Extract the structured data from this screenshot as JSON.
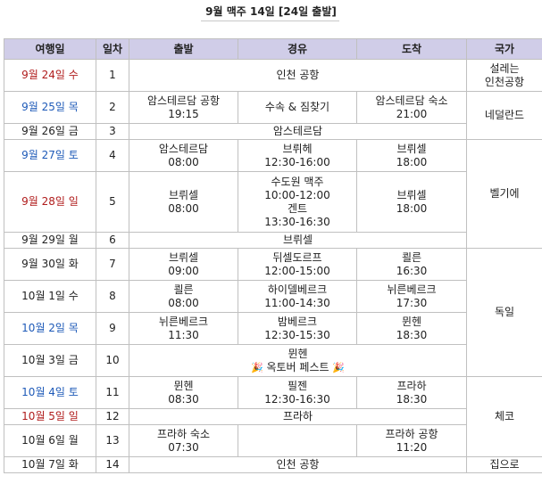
{
  "title": "9월 맥주 14일 [24일 출발]",
  "columns": [
    "여행일",
    "일차",
    "출발",
    "경유",
    "도착",
    "국가"
  ],
  "rows": [
    {
      "date": "9월 24일 수",
      "tone": "red",
      "day": "1",
      "merged": "인천 공항"
    },
    {
      "date": "9월 25일 목",
      "tone": "blue",
      "day": "2",
      "dep": "암스테르담 공항",
      "dep_time": "19:15",
      "via": "수속 & 짐찾기",
      "arr": "암스테르담 숙소",
      "arr_time": "21:00"
    },
    {
      "date": "9월 26일 금",
      "tone": "black",
      "day": "3",
      "merged": "암스테르담"
    },
    {
      "date": "9월 27일 토",
      "tone": "blue",
      "day": "4",
      "dep": "암스테르담",
      "dep_time": "08:00",
      "via": "브뤼헤",
      "via_time": "12:30-16:00",
      "arr": "브뤼셀",
      "arr_time": "18:00"
    },
    {
      "date": "9월 28일 일",
      "tone": "red",
      "day": "5",
      "dep": "브뤼셀",
      "dep_time": "08:00",
      "via": "수도원 맥주",
      "via_time": "10:00-12:00",
      "via2": "겐트",
      "via2_time": "13:30-16:30",
      "arr": "브뤼셀",
      "arr_time": "18:00"
    },
    {
      "date": "9월 29일 월",
      "tone": "black",
      "day": "6",
      "merged": "브뤼셀"
    },
    {
      "date": "9월 30일 화",
      "tone": "black",
      "day": "7",
      "dep": "브뤼셀",
      "dep_time": "09:00",
      "via": "뒤셀도르프",
      "via_time": "12:00-15:00",
      "arr": "쾰른",
      "arr_time": "16:30"
    },
    {
      "date": "10월 1일 수",
      "tone": "black",
      "day": "8",
      "dep": "쾰른",
      "dep_time": "08:00",
      "via": "하이델베르크",
      "via_time": "11:00-14:30",
      "arr": "뉘른베르크",
      "arr_time": "17:30"
    },
    {
      "date": "10월 2일 목",
      "tone": "blue",
      "day": "9",
      "dep": "뉘른베르크",
      "dep_time": "11:30",
      "via": "밤베르크",
      "via_time": "12:30-15:30",
      "arr": "뮌헨",
      "arr_time": "18:30"
    },
    {
      "date": "10월 3일 금",
      "tone": "black",
      "day": "10",
      "merged": "뮌헨",
      "merged2": "옥토버 페스트",
      "merged2_icon": "🎉"
    },
    {
      "date": "10월 4일 토",
      "tone": "blue",
      "day": "11",
      "dep": "뮌헨",
      "dep_time": "08:30",
      "via": "필젠",
      "via_time": "12:30-16:30",
      "arr": "프라하",
      "arr_time": "18:30"
    },
    {
      "date": "10월 5일 일",
      "tone": "red",
      "day": "12",
      "merged": "프라하"
    },
    {
      "date": "10월 6일 월",
      "tone": "black",
      "day": "13",
      "dep": "프라하 숙소",
      "dep_time": "07:30",
      "via": "",
      "arr": "프라하 공항",
      "arr_time": "11:20"
    },
    {
      "date": "10월 7일 화",
      "tone": "black",
      "day": "14",
      "merged": "인천 공항"
    }
  ],
  "countries": [
    {
      "label": "설레는",
      "label2": "인천공항"
    },
    {
      "label": "네덜란드"
    },
    {
      "label": "벨기에"
    },
    {
      "label": "독일"
    },
    {
      "label": "체코"
    },
    {
      "label": "집으로"
    }
  ]
}
